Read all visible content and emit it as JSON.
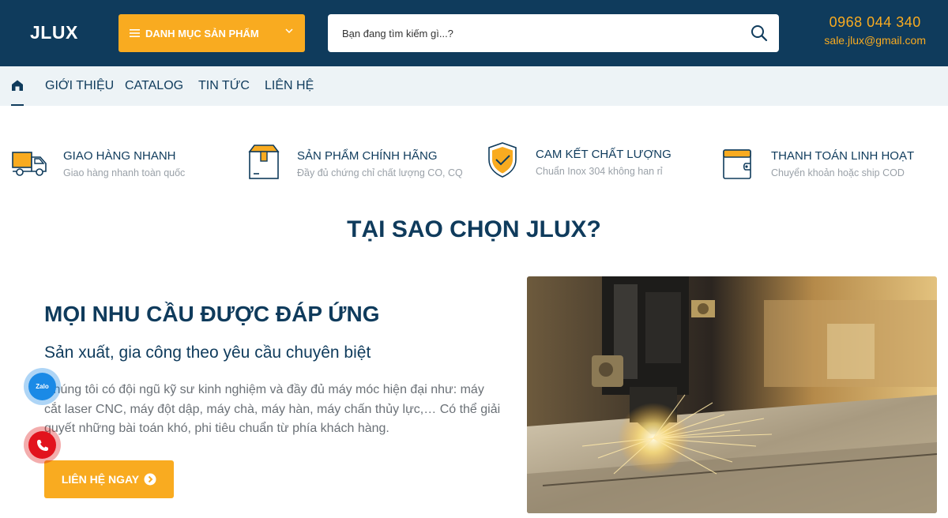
{
  "header": {
    "logo": "JLUX",
    "category_label": "DANH MỤC SẢN PHẨM",
    "search_placeholder": "Bạn đang tìm kiếm gì...?",
    "phone": "0968 044 340",
    "email": "sale.jlux@gmail.com"
  },
  "nav": {
    "items": [
      {
        "label": "GIỚI THIỆU"
      },
      {
        "label": "CATALOG"
      },
      {
        "label": "TIN TỨC"
      },
      {
        "label": "LIÊN HỆ"
      }
    ]
  },
  "features": [
    {
      "title": "GIAO HÀNG NHANH",
      "subtitle": "Giao hàng nhanh toàn quốc",
      "icon": "truck-icon"
    },
    {
      "title": "SẢN PHẨM CHÍNH HÃNG",
      "subtitle": "Đầy đủ chứng chỉ chất lượng CO, CQ",
      "icon": "box-icon"
    },
    {
      "title": "CAM KẾT CHẤT LƯỢNG",
      "subtitle": "Chuẩn Inox 304 không han rỉ",
      "icon": "shield-check-icon"
    },
    {
      "title": "THANH TOÁN LINH HOẠT",
      "subtitle": "Chuyển khoản hoặc ship COD",
      "icon": "wallet-icon"
    }
  ],
  "section": {
    "heading": "TẠI SAO CHỌN JLUX?",
    "title": "MỌI NHU CẦU ĐƯỢC ĐÁP ỨNG",
    "subtitle": "Sản xuất, gia công theo yêu cầu chuyên biệt",
    "body": "Chúng tôi có đội ngũ kỹ sư kinh nghiệm và đầy đủ máy móc hiện đại như: máy cắt laser CNC, máy đột dập, máy chà, máy hàn, máy chấn thủy lực,… Có thể giải quyết những bài toán khó, phi tiêu chuẩn từ phía khách hàng.",
    "cta_label": "LIÊN HỆ NGAY"
  },
  "floating": {
    "zalo_label": "Zalo"
  },
  "colors": {
    "primary": "#0f3b5c",
    "accent": "#f9ab20",
    "nav_bg": "#edf3f6"
  }
}
